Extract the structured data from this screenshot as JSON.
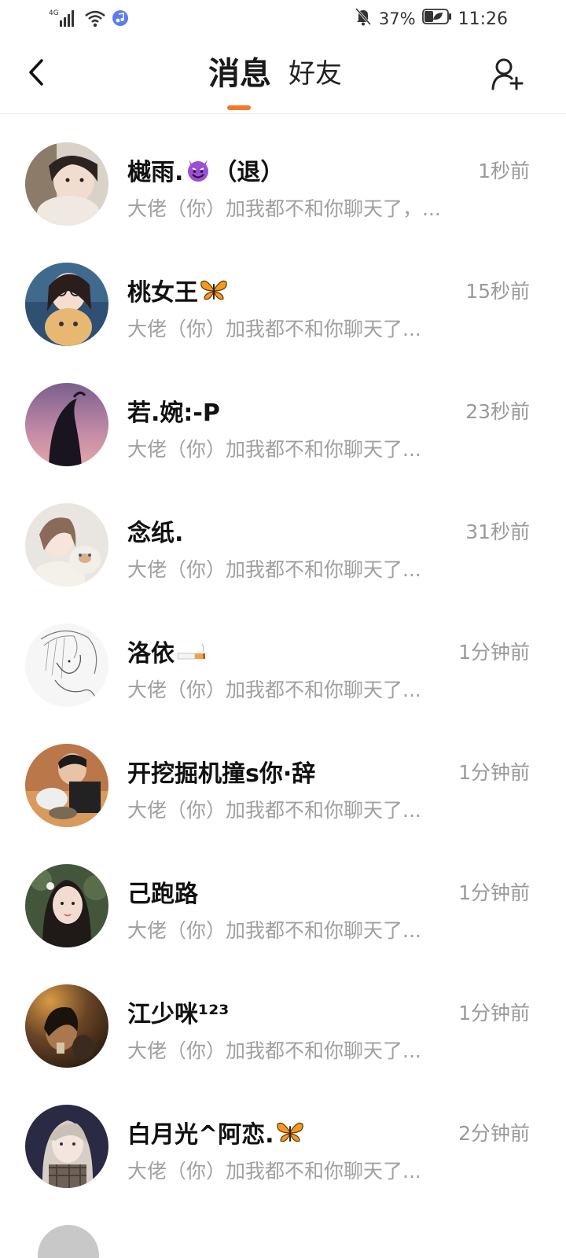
{
  "status_bar": {
    "network": "4G",
    "battery_percent": "37%",
    "time": "11:26"
  },
  "header": {
    "tabs": [
      {
        "label": "消息",
        "active": true
      },
      {
        "label": "好友",
        "active": false
      }
    ],
    "accent_color": "#f5782a"
  },
  "messages": [
    {
      "name": "樾雨.",
      "name_suffix": "（退）",
      "emoji": "smiling-devil-emoji",
      "time": "1秒前",
      "preview": "大佬（你）加我都不和你聊天了，..."
    },
    {
      "name": "桃女王",
      "name_suffix": "",
      "emoji": "butterfly-emoji",
      "time": "15秒前",
      "preview": "大佬（你）加我都不和你聊天了..."
    },
    {
      "name": "若.婉:-P",
      "name_suffix": "",
      "emoji": "",
      "time": "23秒前",
      "preview": "大佬（你）加我都不和你聊天了..."
    },
    {
      "name": "念纸.",
      "name_suffix": "",
      "emoji": "",
      "time": "31秒前",
      "preview": "大佬（你）加我都不和你聊天了..."
    },
    {
      "name": "洛依",
      "name_suffix": "",
      "emoji": "cigarette-emoji",
      "time": "1分钟前",
      "preview": "大佬（你）加我都不和你聊天了..."
    },
    {
      "name": "开挖掘机撞s你·辞",
      "name_suffix": "",
      "emoji": "",
      "time": "1分钟前",
      "preview": "大佬（你）加我都不和你聊天了..."
    },
    {
      "name": "己跑路",
      "name_suffix": "",
      "emoji": "",
      "time": "1分钟前",
      "preview": "大佬（你）加我都不和你聊天了..."
    },
    {
      "name": "江少咪¹²³",
      "name_suffix": "",
      "emoji": "",
      "time": "1分钟前",
      "preview": "大佬（你）加我都不和你聊天了..."
    },
    {
      "name": "白月光^阿恋.",
      "name_suffix": "",
      "emoji": "butterfly-emoji",
      "time": "2分钟前",
      "preview": "大佬（你）加我都不和你聊天了..."
    }
  ]
}
